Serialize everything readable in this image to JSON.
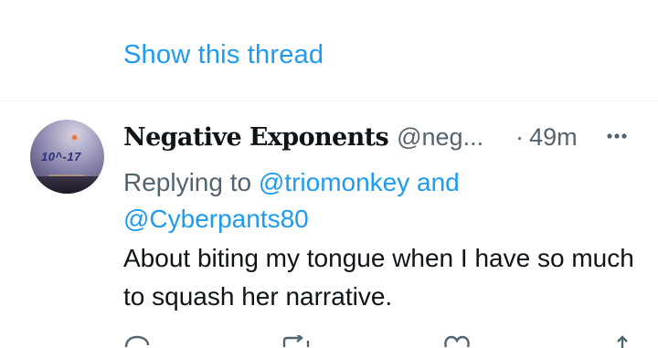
{
  "thread": {
    "show_thread_label": "Show this thread"
  },
  "tweet": {
    "avatar_text": "10^-17",
    "display_name": "Negative Exponents",
    "handle": "@neg...",
    "separator": "·",
    "time": "49m",
    "replying_prefix": "Replying to",
    "reply_to_1": "@triomonkey",
    "reply_connector": "and",
    "reply_to_2": "@Cyberpants80",
    "text": "About biting my tongue when I have so much to squash her narrative."
  },
  "colors": {
    "link": "#1d9bf0",
    "secondary": "#536471",
    "primary": "#0f1419",
    "divider": "#eff3f4"
  },
  "icons": [
    "more-icon",
    "reply-icon",
    "retweet-icon",
    "like-icon",
    "share-icon"
  ]
}
